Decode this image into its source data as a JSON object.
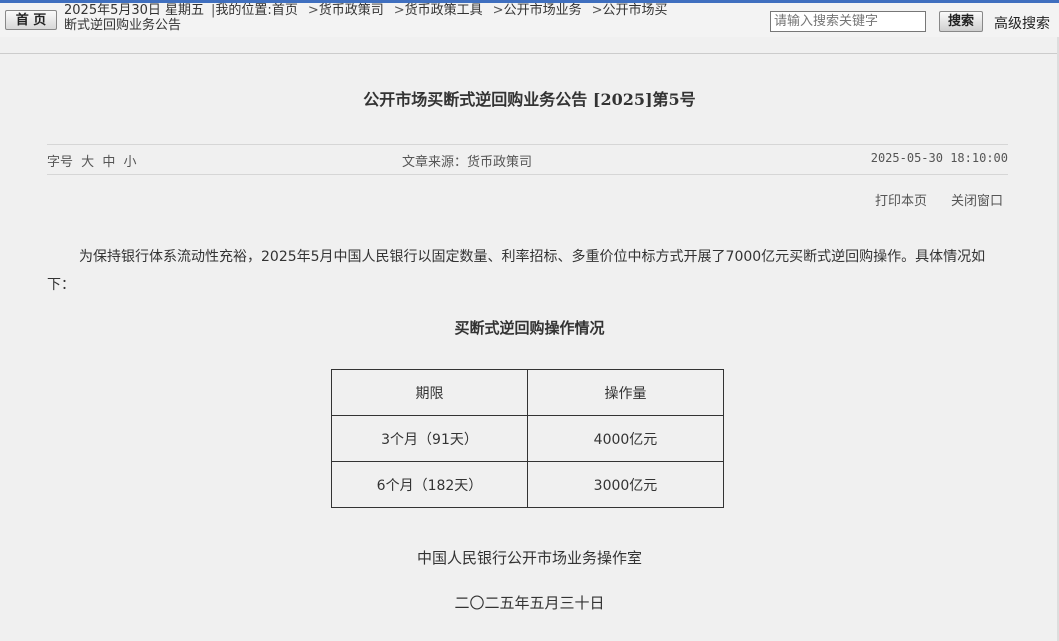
{
  "topbar": {
    "home_label": "首 页",
    "date": "2025年5月30日 星期五",
    "location_prefix": "我的位置:",
    "crumbs": [
      "首页",
      "货币政策司",
      "货币政策工具",
      "公开市场业务",
      "公开市场买"
    ],
    "crumb_line2": "断式逆回购业务公告",
    "search_placeholder": "请输入搜索关键字",
    "search_button": "搜索",
    "advanced_search": "高级搜索"
  },
  "article": {
    "title": "公开市场买断式逆回购业务公告 [2025]第5号",
    "font_size_label": "字号",
    "font_sizes": [
      "大",
      "中",
      "小"
    ],
    "source": "文章来源：货币政策司",
    "datetime": "2025-05-30 18:10:00",
    "print_label": "打印本页",
    "close_label": "关闭窗口",
    "paragraph": "为保持银行体系流动性充裕，2025年5月中国人民银行以固定数量、利率招标、多重价位中标方式开展了7000亿元买断式逆回购操作。具体情况如下：",
    "table_caption": "买断式逆回购操作情况",
    "table": {
      "headers": [
        "期限",
        "操作量"
      ],
      "rows": [
        [
          "3个月（91天）",
          "4000亿元"
        ],
        [
          "6个月（182天）",
          "3000亿元"
        ]
      ]
    },
    "signature": "中国人民银行公开市场业务操作室",
    "sign_date": "二〇二五年五月三十日"
  }
}
